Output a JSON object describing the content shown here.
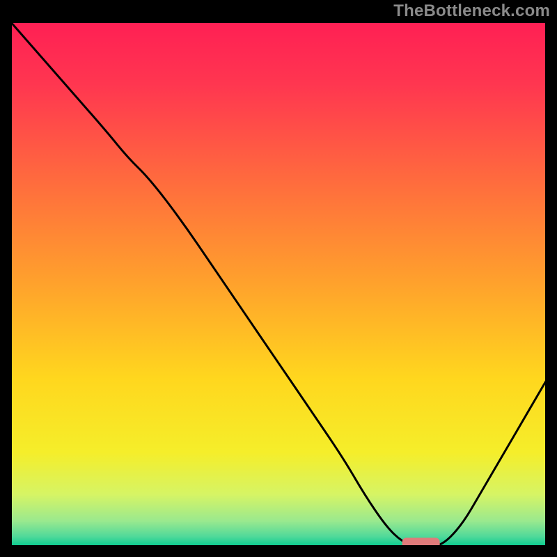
{
  "watermark": "TheBottleneck.com",
  "chart_data": {
    "type": "line",
    "title": "",
    "xlabel": "",
    "ylabel": "",
    "xlim": [
      0,
      100
    ],
    "ylim": [
      0,
      100
    ],
    "background_gradient": {
      "stops": [
        {
          "pos": 0.0,
          "color": "#ff1f54"
        },
        {
          "pos": 0.12,
          "color": "#ff3650"
        },
        {
          "pos": 0.3,
          "color": "#ff6a3e"
        },
        {
          "pos": 0.5,
          "color": "#ffa22c"
        },
        {
          "pos": 0.68,
          "color": "#ffd71e"
        },
        {
          "pos": 0.82,
          "color": "#f5ee2a"
        },
        {
          "pos": 0.9,
          "color": "#d6f465"
        },
        {
          "pos": 0.95,
          "color": "#9ae98e"
        },
        {
          "pos": 0.98,
          "color": "#4fd99a"
        },
        {
          "pos": 1.0,
          "color": "#00c98e"
        }
      ]
    },
    "series": [
      {
        "name": "bottleneck-curve",
        "color": "#000000",
        "x": [
          0,
          6,
          12,
          18,
          22,
          26,
          32,
          38,
          44,
          50,
          56,
          62,
          66,
          70,
          73,
          76,
          80,
          84,
          88,
          92,
          96,
          100
        ],
        "y": [
          100,
          93,
          86,
          79,
          74,
          70,
          62,
          53,
          44,
          35,
          26,
          17,
          10,
          4,
          1,
          0,
          0,
          4,
          11,
          18,
          25,
          32
        ]
      }
    ],
    "marker": {
      "name": "optimal-zone",
      "color": "#e07b7b",
      "x_start": 73,
      "x_end": 80,
      "y": 0,
      "thickness": 1.8
    }
  }
}
